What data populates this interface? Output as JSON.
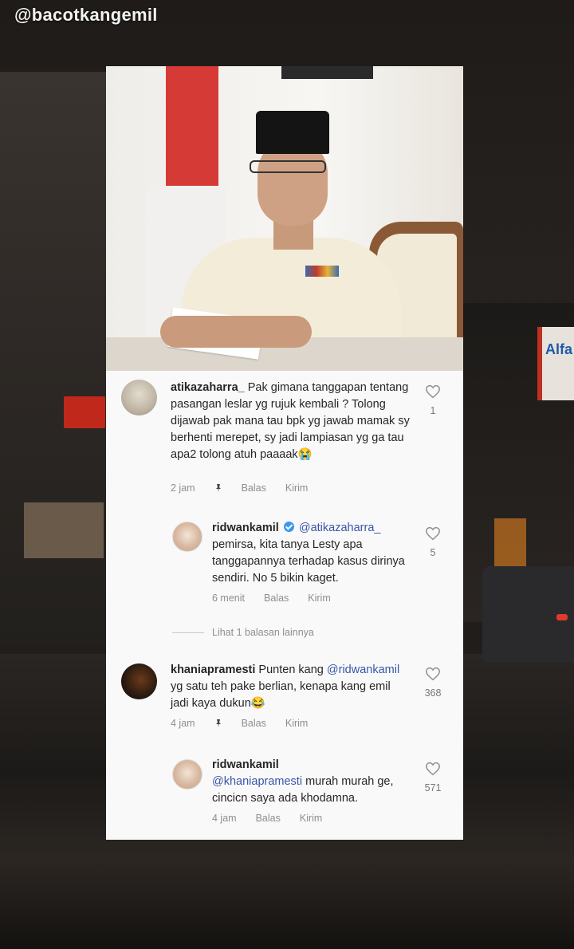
{
  "watermark": "@bacotkangemil",
  "background": {
    "store_sign": "Alfa"
  },
  "comments": [
    {
      "username": "atikazaharra_",
      "text": "Pak gimana tanggapan tentang pasangan leslar yg rujuk kembali ? Tolong dijawab pak mana tau bpk yg jawab mamak sy berhenti merepet, sy jadi lampiasan yg ga tau apa2 tolong atuh paaaak😭",
      "time": "2 jam",
      "reply_label": "Balas",
      "send_label": "Kirim",
      "likes": "1"
    },
    {
      "username": "ridwankamil",
      "mention": "@atikazaharra_",
      "text": "pemirsa, kita tanya Lesty apa tanggapannya terhadap kasus dirinya sendiri. No 5 bikin kaget.",
      "time": "6 menit",
      "reply_label": "Balas",
      "send_label": "Kirim",
      "likes": "5"
    },
    {
      "view_more": "Lihat 1 balasan lainnya"
    },
    {
      "username": "khaniapramesti",
      "text_before": "Punten kang",
      "mention": "@ridwankamil",
      "text": "yg satu teh pake berlian, kenapa kang emil jadi kaya dukun😂",
      "time": "4 jam",
      "reply_label": "Balas",
      "send_label": "Kirim",
      "likes": "368"
    },
    {
      "username": "ridwankamil",
      "mention": "@khaniapramesti",
      "text": "murah murah ge, cincicn saya ada khodamna.",
      "time": "4 jam",
      "reply_label": "Balas",
      "send_label": "Kirim",
      "likes": "571"
    }
  ]
}
